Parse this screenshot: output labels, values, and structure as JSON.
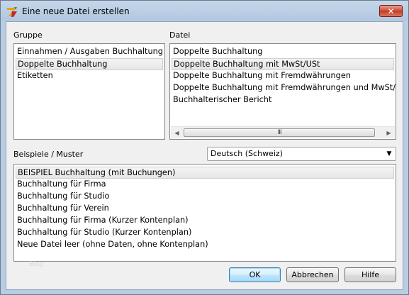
{
  "window": {
    "title": "Eine neue Datei erstellen",
    "close_label": "✕"
  },
  "group": {
    "label": "Gruppe",
    "items": [
      "Einnahmen / Ausgaben Buchhaltung",
      "Doppelte Buchhaltung",
      "Etiketten"
    ],
    "selected_index": 1
  },
  "file": {
    "label": "Datei",
    "items": [
      "Doppelte Buchhaltung",
      "Doppelte Buchhaltung mit MwSt/USt",
      "Doppelte Buchhaltung mit Fremdwährungen",
      "Doppelte Buchhaltung mit Fremdwährungen und MwSt/USt",
      "Buchhalterischer Bericht"
    ],
    "selected_index": 1,
    "scroll_left": "◀",
    "scroll_right": "▶",
    "thumb_grip": "III"
  },
  "examples": {
    "label": "Beispiele / Muster",
    "items": [
      "BEISPIEL Buchhaltung (mit Buchungen)",
      "Buchhaltung für Firma",
      "Buchhaltung für Studio",
      "Buchhaltung für Verein",
      "Buchhaltung für Firma (Kurzer Kontenplan)",
      "Buchhaltung für Studio (Kurzer Kontenplan)",
      "Neue Datei leer (ohne Daten, ohne Kontenplan)"
    ],
    "selected_index": 0
  },
  "language": {
    "value": "Deutsch (Schweiz)",
    "arrow": "▼"
  },
  "buttons": {
    "ok": "OK",
    "cancel": "Abbrechen",
    "help": "Hilfe"
  },
  "ghost": "Blog"
}
